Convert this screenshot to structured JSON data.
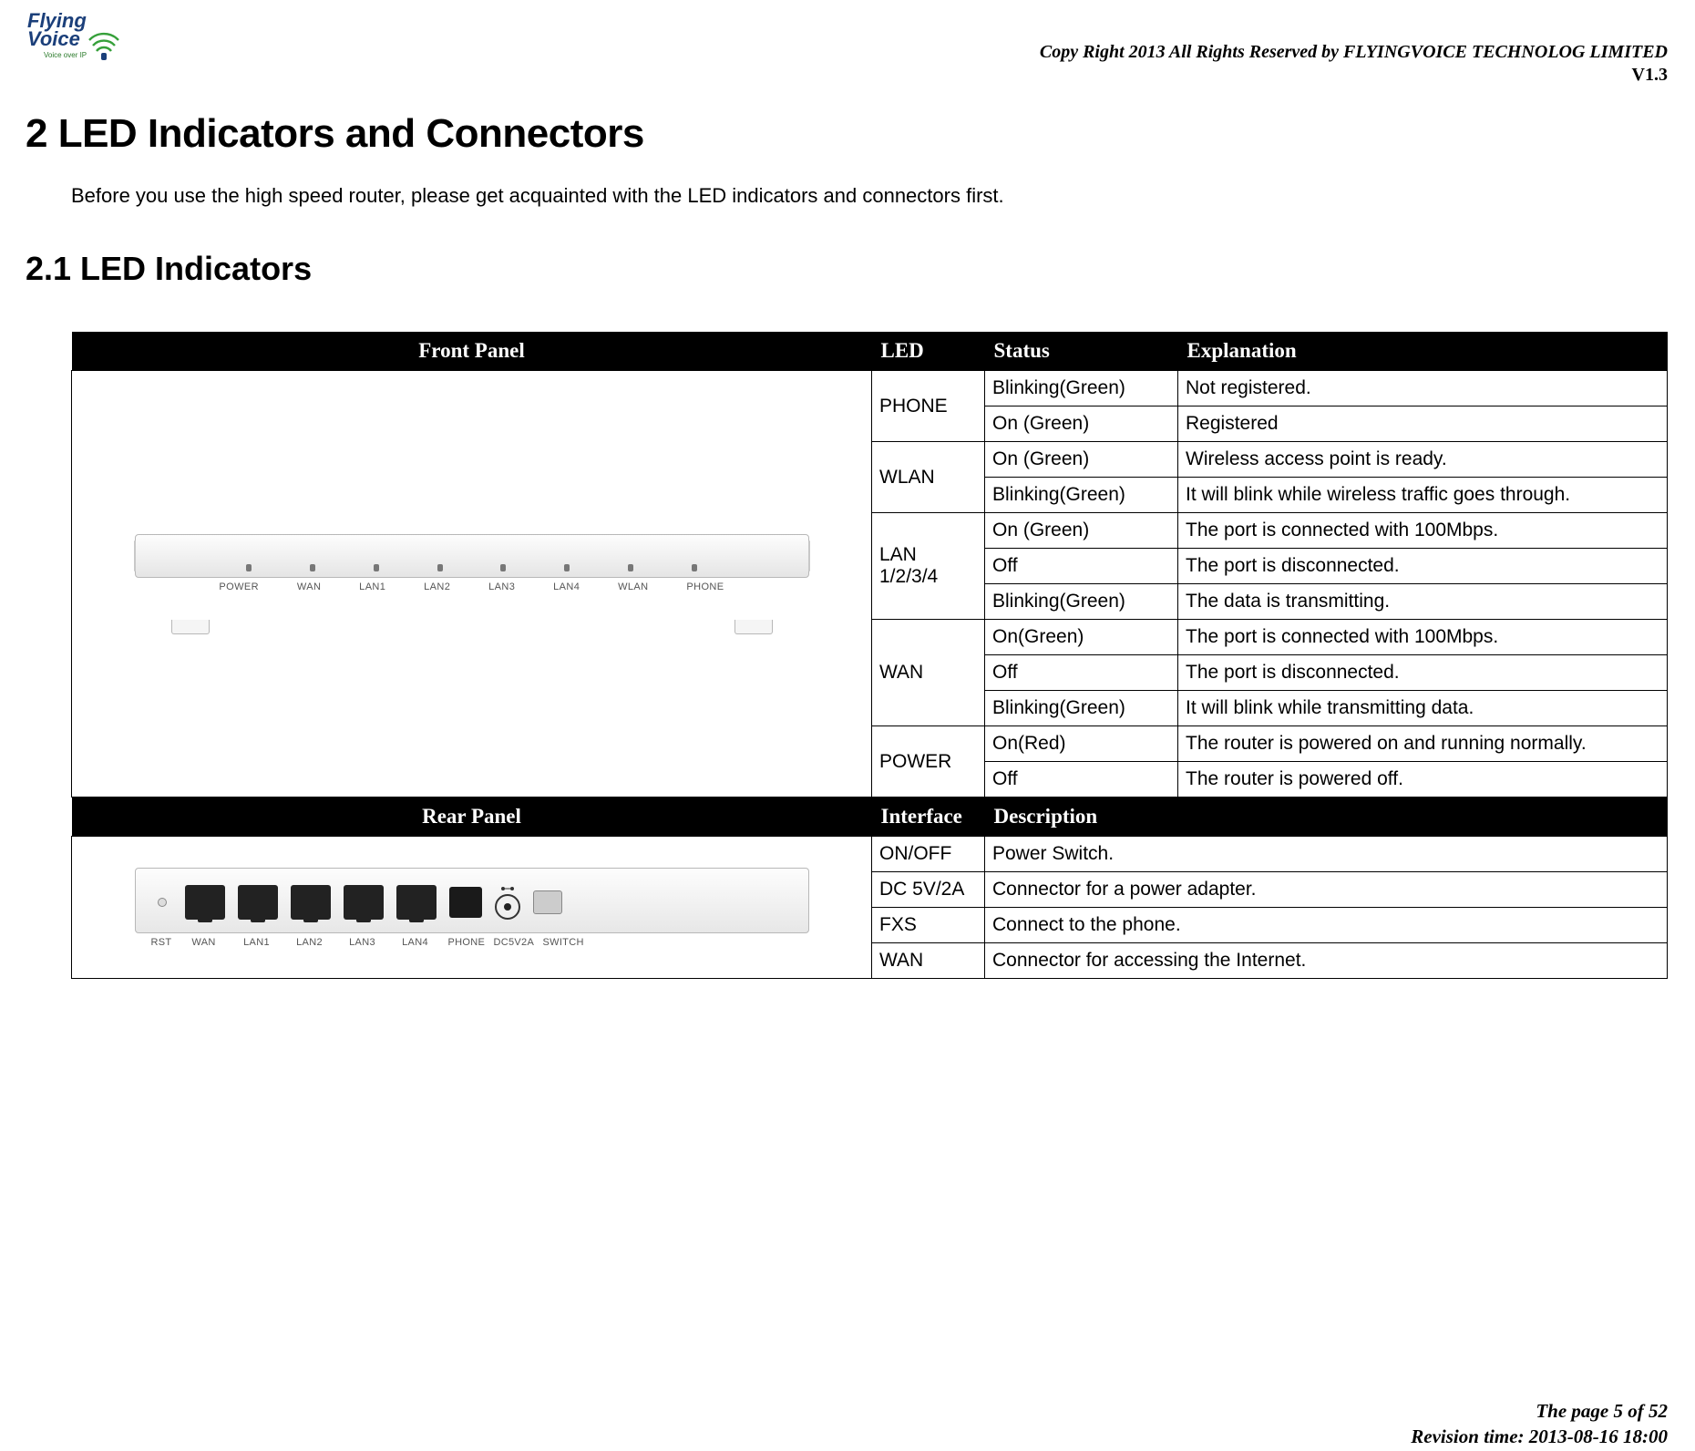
{
  "header": {
    "logo_text_top": "Flying",
    "logo_text_bottom": "Voice",
    "logo_tagline": "Voice over IP",
    "copyright": "Copy Right 2013 All Rights Reserved by FLYINGVOICE TECHNOLOG LIMITED",
    "version": "V1.3"
  },
  "section": {
    "h1": "2   LED Indicators and Connectors",
    "intro": "Before you use the high speed router, please get acquainted with the LED indicators and connectors first.",
    "h2": "2.1 LED Indicators"
  },
  "front_table": {
    "headers": [
      "Front Panel",
      "LED",
      "Status",
      "Explanation"
    ],
    "device_labels": [
      "POWER",
      "WAN",
      "LAN1",
      "LAN2",
      "LAN3",
      "LAN4",
      "WLAN",
      "PHONE"
    ],
    "rows": [
      {
        "led": "PHONE",
        "rowspan": 2,
        "status": "Blinking(Green)",
        "exp": "Not registered."
      },
      {
        "status": "On (Green)",
        "exp": "Registered"
      },
      {
        "led": "WLAN",
        "rowspan": 2,
        "status": "On (Green)",
        "exp": "Wireless access point is ready."
      },
      {
        "status": "Blinking(Green)",
        "exp": "It will blink while wireless traffic goes through."
      },
      {
        "led": "LAN 1/2/3/4",
        "rowspan": 3,
        "status": "On (Green)",
        "exp": "The port is connected with 100Mbps."
      },
      {
        "status": "Off",
        "exp": "The port is disconnected."
      },
      {
        "status": "Blinking(Green)",
        "exp": "The data is transmitting."
      },
      {
        "led": "WAN",
        "rowspan": 3,
        "status": "On(Green)",
        "exp": "The port is connected with 100Mbps."
      },
      {
        "status": "Off",
        "exp": "The port is disconnected."
      },
      {
        "status": "Blinking(Green)",
        "exp": "It will blink while transmitting data."
      },
      {
        "led": "POWER",
        "rowspan": 2,
        "status": "On(Red)",
        "exp": "The router is powered on and running normally."
      },
      {
        "status": "Off",
        "exp": "The router is powered off."
      }
    ]
  },
  "rear_table": {
    "headers": [
      "Rear Panel",
      "Interface",
      "Description"
    ],
    "device_labels": [
      "RST",
      "WAN",
      "LAN1",
      "LAN2",
      "LAN3",
      "LAN4",
      "PHONE",
      "DC5V2A",
      "SWITCH"
    ],
    "rows": [
      {
        "iface": "ON/OFF",
        "desc": "Power Switch."
      },
      {
        "iface": "DC 5V/2A",
        "desc": "Connector for a power adapter."
      },
      {
        "iface": "FXS",
        "desc": "Connect to the phone."
      },
      {
        "iface": "WAN",
        "desc": "Connector for accessing the Internet."
      }
    ]
  },
  "footer": {
    "page": "The page 5 of 52",
    "revision": "Revision time: 2013-08-16 18:00"
  }
}
